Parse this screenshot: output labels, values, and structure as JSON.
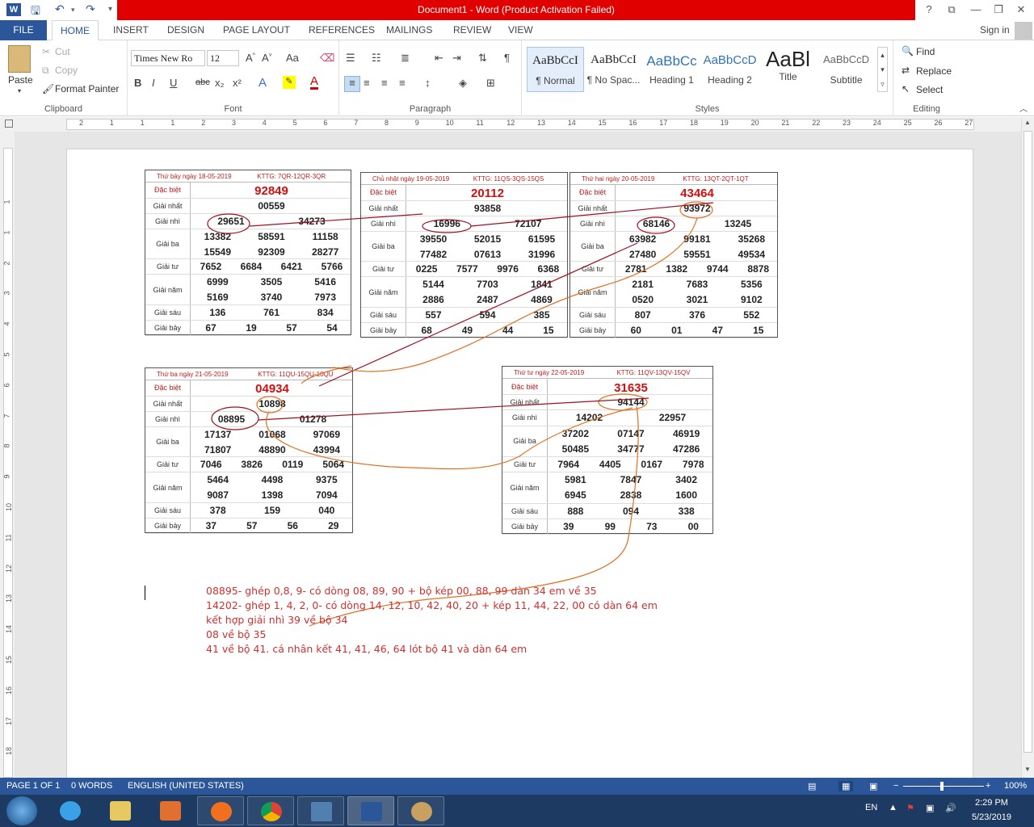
{
  "window": {
    "title": "Document1 - Word (Product Activation Failed)",
    "app_icon": "W"
  },
  "titlebar_buttons": {
    "help": "?",
    "restore_ribbon": "⧉",
    "minimize": "—",
    "maximize": "❐",
    "close": "✕"
  },
  "quick_access": {
    "save": "save-icon",
    "undo": "undo-icon",
    "redo": "redo-icon"
  },
  "tabs": [
    "FILE",
    "HOME",
    "INSERT",
    "DESIGN",
    "PAGE LAYOUT",
    "REFERENCES",
    "MAILINGS",
    "REVIEW",
    "VIEW"
  ],
  "active_tab": "HOME",
  "sign_in": "Sign in",
  "clipboard": {
    "paste": "Paste",
    "cut": "Cut",
    "copy": "Copy",
    "format_painter": "Format Painter",
    "label": "Clipboard"
  },
  "font": {
    "name": "Times New Ro",
    "size": "12",
    "label": "Font",
    "bold": "B",
    "italic": "I",
    "underline": "U",
    "strike": "abc",
    "sub": "x₂",
    "sup": "x²",
    "grow": "A^",
    "shrink": "A˅",
    "case": "Aa"
  },
  "paragraph": {
    "label": "Paragraph"
  },
  "styles": {
    "label": "Styles",
    "items": [
      {
        "preview": "AaBbCcI",
        "name": "¶ Normal"
      },
      {
        "preview": "AaBbCcI",
        "name": "¶ No Spac..."
      },
      {
        "preview": "AaBbCc",
        "name": "Heading 1"
      },
      {
        "preview": "AaBbCcD",
        "name": "Heading 2"
      },
      {
        "preview": "AaBl",
        "name": "Title"
      },
      {
        "preview": "AaBbCcD",
        "name": "Subtitle"
      }
    ]
  },
  "editing": {
    "label": "Editing",
    "find": "Find",
    "replace": "Replace",
    "select": "Select"
  },
  "ruler": [
    "2",
    "1",
    "1",
    "1",
    "2",
    "3",
    "4",
    "5",
    "6",
    "7",
    "8",
    "9",
    "10",
    "11",
    "12",
    "13",
    "14",
    "15",
    "16",
    "17",
    "18",
    "19",
    "20",
    "21",
    "22",
    "23",
    "24",
    "25",
    "26",
    "27"
  ],
  "vruler": [
    "1",
    "1",
    "2",
    "3",
    "4",
    "5",
    "6",
    "7",
    "8",
    "9",
    "10",
    "11",
    "12",
    "13",
    "14",
    "15",
    "16",
    "17",
    "18",
    "19"
  ],
  "tables": [
    {
      "header_left": "Thứ bảy ngày 18-05-2019",
      "header_right": "KTTG: 7QR-12QR-3QR",
      "rows": [
        {
          "label": "Đặc biệt",
          "values": [
            "92849"
          ]
        },
        {
          "label": "Giải nhất",
          "values": [
            "00559"
          ]
        },
        {
          "label": "Giải nhì",
          "values": [
            "29651",
            "34273"
          ]
        },
        {
          "label": "Giải ba",
          "values": [
            "13382",
            "58591",
            "11158",
            "15549",
            "92309",
            "28277"
          ]
        },
        {
          "label": "Giải tư",
          "values": [
            "7652",
            "6684",
            "6421",
            "5766"
          ]
        },
        {
          "label": "Giải năm",
          "values": [
            "6999",
            "3505",
            "5416",
            "5169",
            "3740",
            "7973"
          ]
        },
        {
          "label": "Giải sáu",
          "values": [
            "136",
            "761",
            "834"
          ]
        },
        {
          "label": "Giải bảy",
          "values": [
            "67",
            "19",
            "57",
            "54"
          ]
        }
      ]
    },
    {
      "header_left": "Chủ nhật ngày 19-05-2019",
      "header_right": "KTTG: 11QS-3QS-15QS",
      "rows": [
        {
          "label": "Đặc biệt",
          "values": [
            "20112"
          ]
        },
        {
          "label": "Giải nhất",
          "values": [
            "93858"
          ]
        },
        {
          "label": "Giải nhì",
          "values": [
            "16996",
            "72107"
          ]
        },
        {
          "label": "Giải ba",
          "values": [
            "39550",
            "52015",
            "61595",
            "77482",
            "07613",
            "31996"
          ]
        },
        {
          "label": "Giải tư",
          "values": [
            "0225",
            "7577",
            "9976",
            "6368"
          ]
        },
        {
          "label": "Giải năm",
          "values": [
            "5144",
            "7703",
            "1841",
            "2886",
            "2487",
            "4869"
          ]
        },
        {
          "label": "Giải sáu",
          "values": [
            "557",
            "594",
            "385"
          ]
        },
        {
          "label": "Giải bảy",
          "values": [
            "68",
            "49",
            "44",
            "15"
          ]
        }
      ]
    },
    {
      "header_left": "Thứ hai ngày 20-05-2019",
      "header_right": "KTTG: 13QT-2QT-1QT",
      "rows": [
        {
          "label": "Đặc biệt",
          "values": [
            "43464"
          ]
        },
        {
          "label": "Giải nhất",
          "values": [
            "93972"
          ]
        },
        {
          "label": "Giải nhì",
          "values": [
            "68146",
            "13245"
          ]
        },
        {
          "label": "Giải ba",
          "values": [
            "63982",
            "99181",
            "35268",
            "27480",
            "59551",
            "49534"
          ]
        },
        {
          "label": "Giải tư",
          "values": [
            "2781",
            "1382",
            "9744",
            "8878"
          ]
        },
        {
          "label": "Giải năm",
          "values": [
            "2181",
            "7683",
            "5356",
            "0520",
            "3021",
            "9102"
          ]
        },
        {
          "label": "Giải sáu",
          "values": [
            "807",
            "376",
            "552"
          ]
        },
        {
          "label": "Giải bảy",
          "values": [
            "60",
            "01",
            "47",
            "15"
          ]
        }
      ]
    },
    {
      "header_left": "Thứ ba ngày 21-05-2019",
      "header_right": "KTTG: 11QU-15QU-10QU",
      "rows": [
        {
          "label": "Đặc biệt",
          "values": [
            "04934"
          ]
        },
        {
          "label": "Giải nhất",
          "values": [
            "10898"
          ]
        },
        {
          "label": "Giải nhì",
          "values": [
            "08895",
            "01278"
          ]
        },
        {
          "label": "Giải ba",
          "values": [
            "17137",
            "01068",
            "97069",
            "71807",
            "48890",
            "43994"
          ]
        },
        {
          "label": "Giải tư",
          "values": [
            "7046",
            "3826",
            "0119",
            "5064"
          ]
        },
        {
          "label": "Giải năm",
          "values": [
            "5464",
            "4498",
            "9375",
            "9087",
            "1398",
            "7094"
          ]
        },
        {
          "label": "Giải sáu",
          "values": [
            "378",
            "159",
            "040"
          ]
        },
        {
          "label": "Giải bảy",
          "values": [
            "37",
            "57",
            "56",
            "29"
          ]
        }
      ]
    },
    {
      "header_left": "Thứ tư ngày 22-05-2019",
      "header_right": "KTTG: 11QV-13QV-15QV",
      "rows": [
        {
          "label": "Đặc biệt",
          "values": [
            "31635"
          ]
        },
        {
          "label": "Giải nhất",
          "values": [
            "94144"
          ]
        },
        {
          "label": "Giải nhì",
          "values": [
            "14202",
            "22957"
          ]
        },
        {
          "label": "Giải ba",
          "values": [
            "37202",
            "07147",
            "46919",
            "50485",
            "34777",
            "47286"
          ]
        },
        {
          "label": "Giải tư",
          "values": [
            "7964",
            "4405",
            "0167",
            "7978"
          ]
        },
        {
          "label": "Giải năm",
          "values": [
            "5981",
            "7847",
            "3402",
            "6945",
            "2838",
            "1600"
          ]
        },
        {
          "label": "Giải sáu",
          "values": [
            "888",
            "094",
            "338"
          ]
        },
        {
          "label": "Giải bảy",
          "values": [
            "39",
            "99",
            "73",
            "00"
          ]
        }
      ]
    }
  ],
  "notes": [
    "08895- ghép 0,8, 9- có dòng 08, 89, 90 + bộ kép 00, 88, 99 dàn 34 em về 35",
    "14202- ghép 1, 4, 2, 0- có dòng 14, 12, 10, 42, 40, 20 + kép 11, 44, 22, 00 có dàn 64 em",
    "kết hợp giải nhì 39 về bộ 34",
    "08 về bộ 35",
    "41 về bộ 41. cá nhân kết  41, 41, 46, 64 lót bộ 41 và dàn 64 em"
  ],
  "status": {
    "page": "PAGE 1 OF 1",
    "words": "0 WORDS",
    "language": "ENGLISH (UNITED STATES)",
    "zoom": "100%",
    "zoom_minus": "−",
    "zoom_plus": "+"
  },
  "tray": {
    "lang": "EN",
    "time": "2:29 PM",
    "date": "5/23/2019"
  },
  "colors": {
    "word_blue": "#2b579a",
    "title_red": "#e00000",
    "note_red": "#d03030",
    "line_red": "#a01020",
    "line_orange": "#e07020"
  }
}
